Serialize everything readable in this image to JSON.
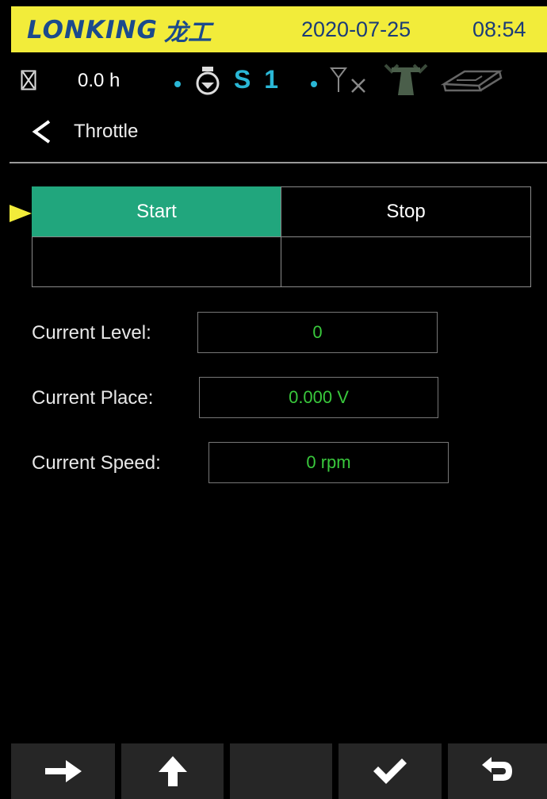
{
  "header": {
    "brand": "LONKING",
    "brand_cn": "龙工",
    "date": "2020-07-25",
    "time": "08:54",
    "bar_color": "#f2ec3a",
    "brand_color": "#1b4a8c"
  },
  "status": {
    "hours": "0.0 h",
    "gear": "S 1",
    "icons": [
      "hourglass-icon",
      "engine-icon",
      "no-signal-icon",
      "antenna-tower-icon",
      "map-icon"
    ],
    "accent_color": "#2ab7d6"
  },
  "page": {
    "title": "Throttle",
    "back_icon": "chevron-left-icon"
  },
  "controls": {
    "start_label": "Start",
    "stop_label": "Stop",
    "active_color": "#21a67d",
    "selected": "Start"
  },
  "readings": {
    "level_label": "Current Level:",
    "level_value": "0",
    "place_label": "Current Place:",
    "place_value": "0.000 V",
    "speed_label": "Current Speed:",
    "speed_value": "0 rpm",
    "value_color": "#39c83c"
  },
  "footer": {
    "buttons": [
      "arrow-right-icon",
      "arrow-up-icon",
      "empty",
      "check-icon",
      "return-icon"
    ]
  }
}
